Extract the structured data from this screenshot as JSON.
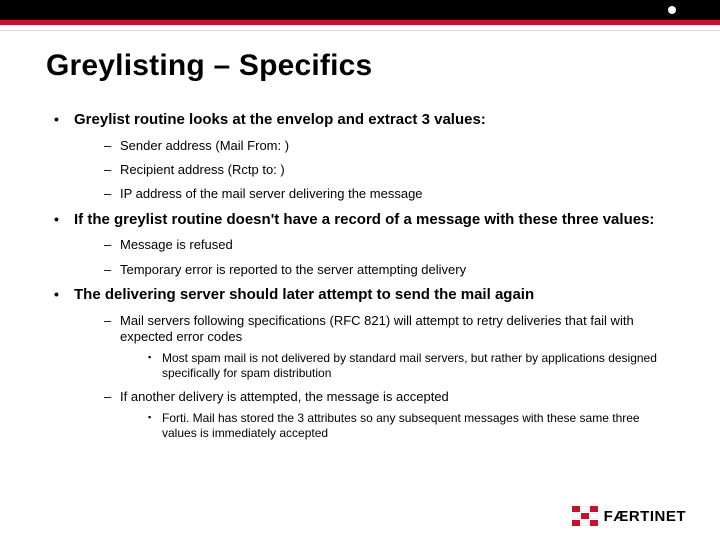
{
  "title": "Greylisting – Specifics",
  "bullets": [
    {
      "text": "Greylist routine looks at the envelop and extract 3 values:",
      "sub": [
        {
          "text": "Sender address (Mail From: )"
        },
        {
          "text": "Recipient address (Rctp to: )"
        },
        {
          "text": "IP address of the mail server delivering the message"
        }
      ]
    },
    {
      "text": "If the greylist routine doesn't have a record of a message with these three values:",
      "sub": [
        {
          "text": "Message is refused"
        },
        {
          "text": "Temporary error is reported to the server attempting delivery"
        }
      ]
    },
    {
      "text": "The delivering server should later attempt to send the mail again",
      "sub": [
        {
          "text": "Mail servers following specifications (RFC 821) will attempt to retry deliveries that fail with expected error codes",
          "sub": [
            {
              "text": "Most spam mail is not delivered by standard mail servers, but rather by applications designed specifically for spam distribution"
            }
          ]
        },
        {
          "text": "If another delivery is attempted, the message is accepted",
          "sub": [
            {
              "text": "Forti. Mail has stored the 3 attributes so any subsequent messages with these same three values is immediately accepted"
            }
          ]
        }
      ]
    }
  ],
  "logo": {
    "text": "FÆRTINET"
  }
}
